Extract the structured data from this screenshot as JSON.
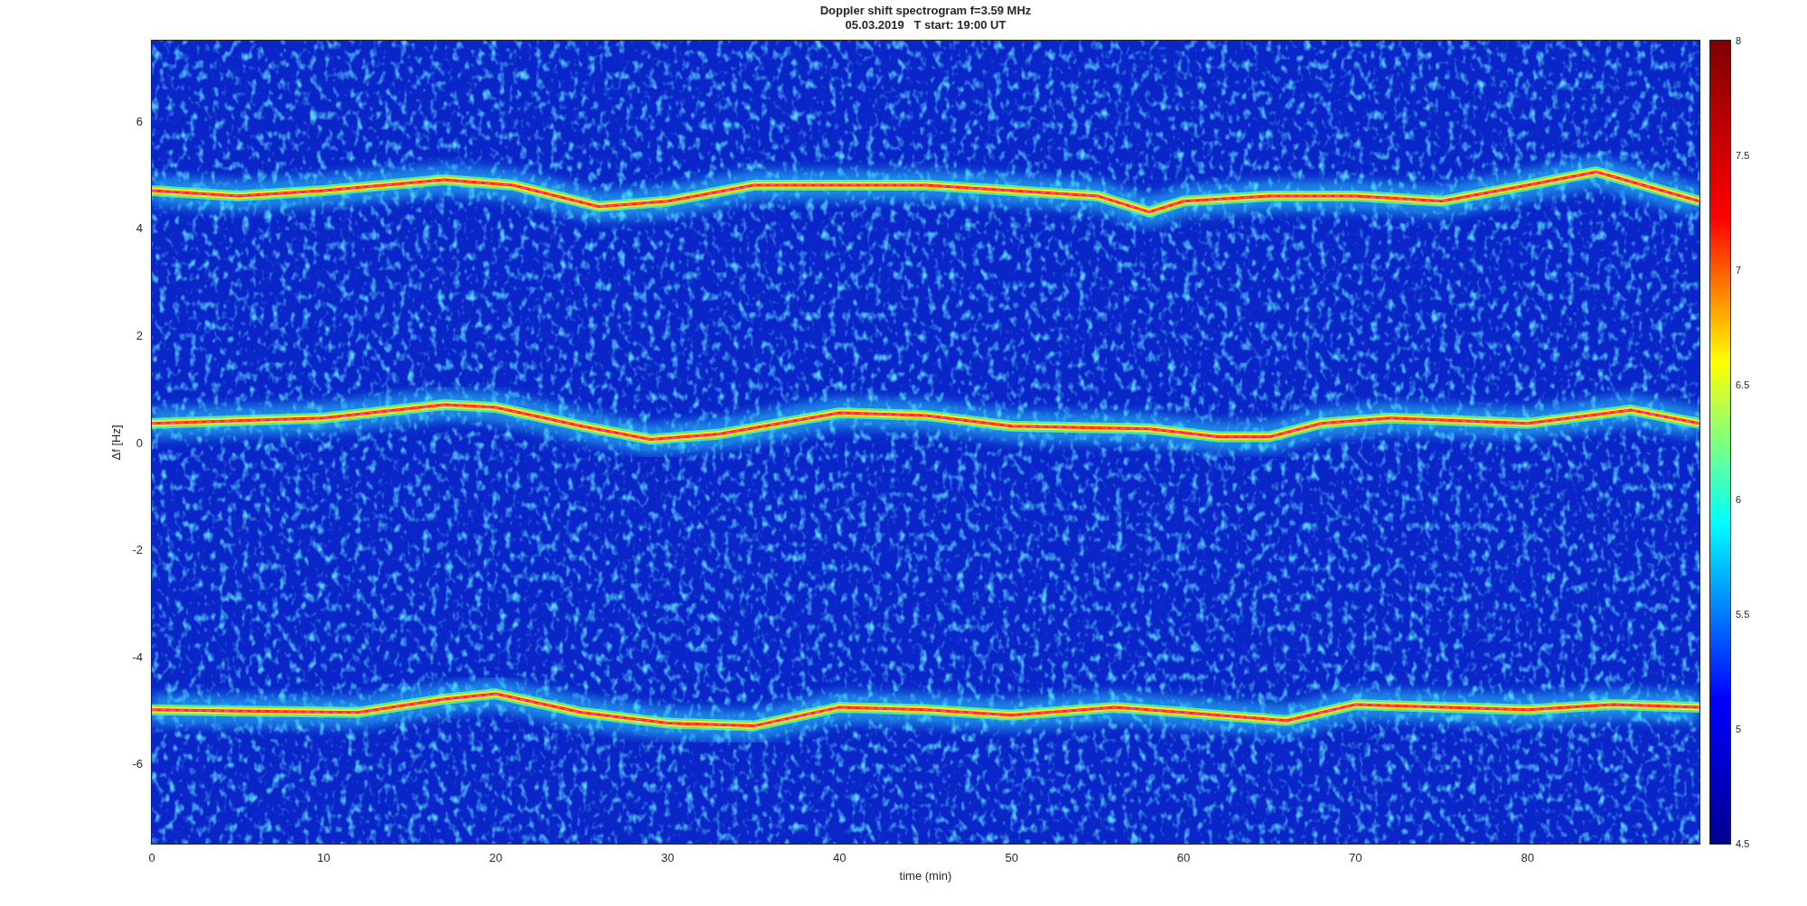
{
  "figure": {
    "title": "Doppler shift spectrogram f=3.59 MHz",
    "subtitle": "05.03.2019   T start: 19:00 UT"
  },
  "axes": {
    "xlabel": "time (min)",
    "ylabel": "Δf [Hz]",
    "xticks": [
      "0",
      "10",
      "20",
      "30",
      "40",
      "50",
      "60",
      "70",
      "80"
    ],
    "yticks": [
      "6",
      "4",
      "2",
      "0",
      "-2",
      "-4",
      "-6"
    ]
  },
  "colorbar": {
    "ticks": [
      "8",
      "7.5",
      "7",
      "6.5",
      "6",
      "5.5",
      "5",
      "4.5"
    ]
  }
}
